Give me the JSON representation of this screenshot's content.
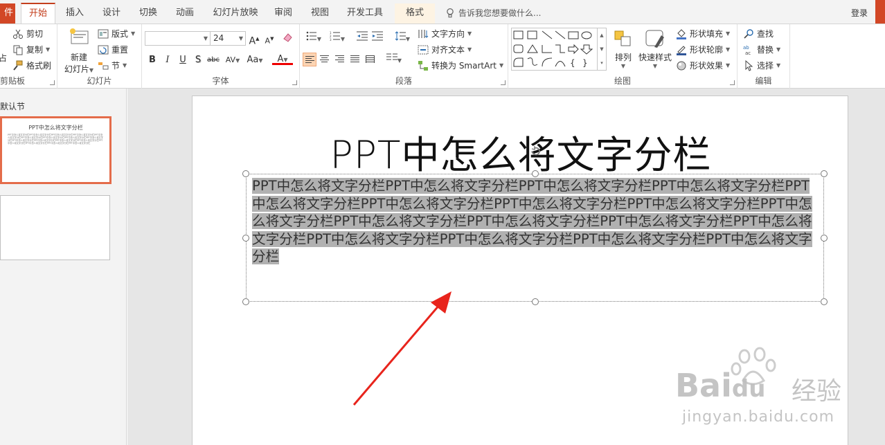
{
  "tabs": {
    "file": "件",
    "items": [
      "开始",
      "插入",
      "设计",
      "切换",
      "动画",
      "幻灯片放映",
      "审阅",
      "视图",
      "开发工具",
      "格式"
    ],
    "tell_me": "告诉我您想要做什么...",
    "login": "登录"
  },
  "ribbon": {
    "clipboard": {
      "paste": "占",
      "cut": "剪切",
      "copy": "复制",
      "painter": "格式刷",
      "label": "剪贴板"
    },
    "slides": {
      "new_line1": "新建",
      "new_line2": "幻灯片",
      "layout": "版式",
      "reset": "重置",
      "section": "节",
      "label": "幻灯片"
    },
    "font": {
      "font_name": "",
      "font_size": "24",
      "bold": "B",
      "italic": "I",
      "underline": "U",
      "shadow": "S",
      "strike": "abc",
      "spacing": "AV",
      "case": "Aa",
      "color": "A",
      "grow": "A",
      "shrink": "A",
      "label": "字体"
    },
    "paragraph": {
      "text_direction": "文字方向",
      "align_text": "对齐文本",
      "smartart": "转换为 SmartArt",
      "label": "段落"
    },
    "drawing": {
      "arrange": "排列",
      "quick_styles": "快速样式",
      "fill": "形状填充",
      "outline": "形状轮廓",
      "effects": "形状效果",
      "label": "绘图"
    },
    "editing": {
      "find": "查找",
      "replace": "替换",
      "select": "选择",
      "label": "编辑"
    }
  },
  "left_panel": {
    "section": "默认节",
    "thumb_title": "PPT中怎么将文字分栏",
    "thumb_body": "PPT中怎么将文字分栏PPT中怎么将文字分栏PPT中怎么将文字分栏PPT中怎么将文字分栏PPT中怎么将文字分栏PPT中怎么将文字分栏PPT中怎么将文字分栏PPT中怎么将文字分栏PPT中怎么将文字分栏PPT中怎么将文字分栏PPT中怎么将文字分栏PPT中怎么将文字分栏PPT中怎么将文字分栏PPT中怎么将文字分栏PPT中怎么将文字分栏PPT中怎么将文字分栏PPT中怎么将文字分栏"
  },
  "slide": {
    "title": "PPT中怎么将文字分栏",
    "body": "PPT中怎么将文字分栏PPT中怎么将文字分栏PPT中怎么将文字分栏PPT中怎么将文字分栏PPT中怎么将文字分栏PPT中怎么将文字分栏PPT中怎么将文字分栏PPT中怎么将文字分栏PPT中怎么将文字分栏PPT中怎么将文字分栏PPT中怎么将文字分栏PPT中怎么将文字分栏PPT中怎么将文字分栏PPT中怎么将文字分栏PPT中怎么将文字分栏PPT中怎么将文字分栏PPT中怎么将文字分栏"
  },
  "watermark": {
    "brand": "Bai",
    "brand2": "du",
    "cn": "经验",
    "url": "jingyan.baidu.com"
  },
  "colors": {
    "accent": "#c43e1c",
    "file_tab": "#d24726",
    "selection": "#b1b1b1",
    "arrow": "#e8241c",
    "thumb_border": "#e46c4a"
  },
  "icons": {
    "search": "lightbulb-icon",
    "cut": "scissors-icon",
    "copy": "copy-icon",
    "painter": "brush-icon"
  }
}
